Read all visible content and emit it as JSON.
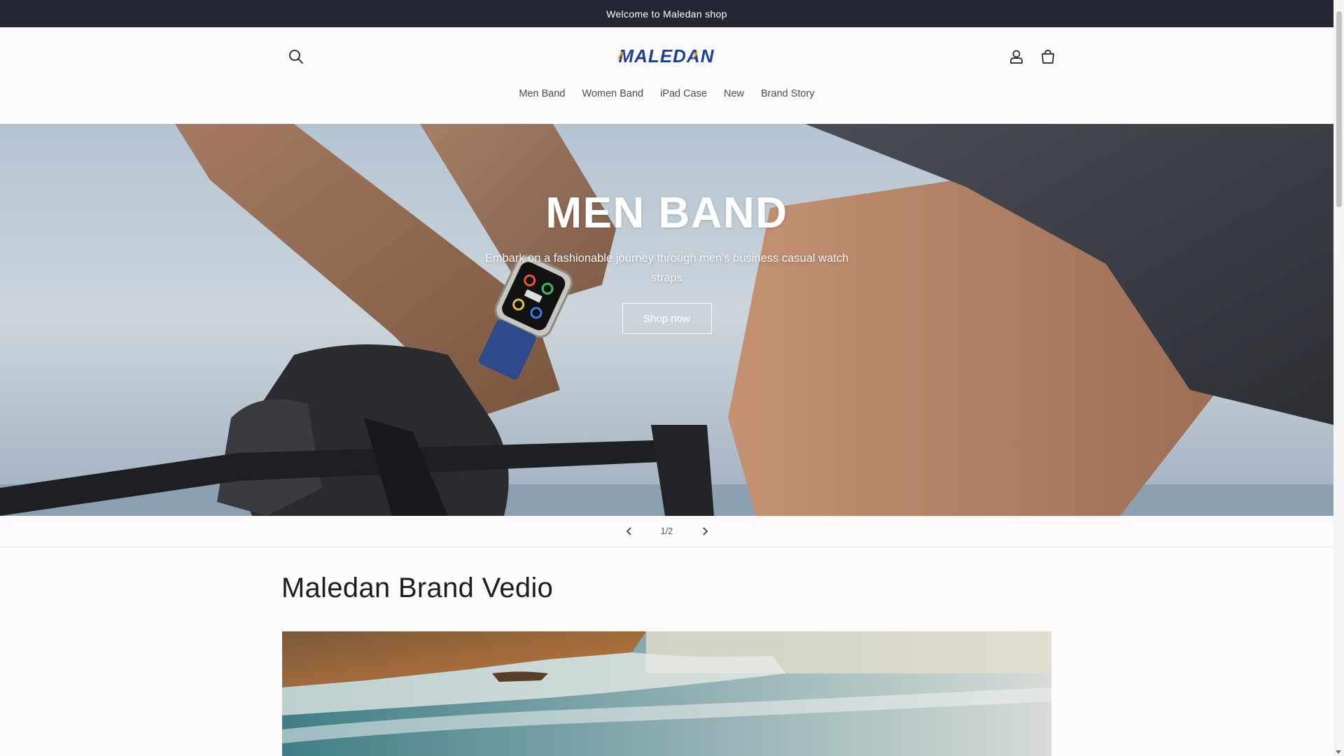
{
  "announcement": {
    "text": "Welcome to Maledan shop"
  },
  "header": {
    "logo_text": "MALEDAN",
    "icons": {
      "search": "search-icon",
      "account": "user-icon",
      "cart": "shopping-bag-icon"
    }
  },
  "nav": {
    "items": [
      {
        "label": "Men Band"
      },
      {
        "label": "Women Band"
      },
      {
        "label": "iPad Case"
      },
      {
        "label": "New"
      },
      {
        "label": "Brand Story"
      }
    ]
  },
  "hero": {
    "title": "MEN BAND",
    "subtitle": "Embark on a fashionable journey through men's business casual watch straps",
    "button_label": "Shop now"
  },
  "slider": {
    "counter": "1/2",
    "current": 1,
    "total": 2
  },
  "video_section": {
    "title": "Maledan Brand Vedio"
  },
  "colors": {
    "announcement_bg": "#222731",
    "logo_blue": "#1a3fa0",
    "logo_accent": "#f0a020",
    "page_bg": "#fdfbfc"
  }
}
